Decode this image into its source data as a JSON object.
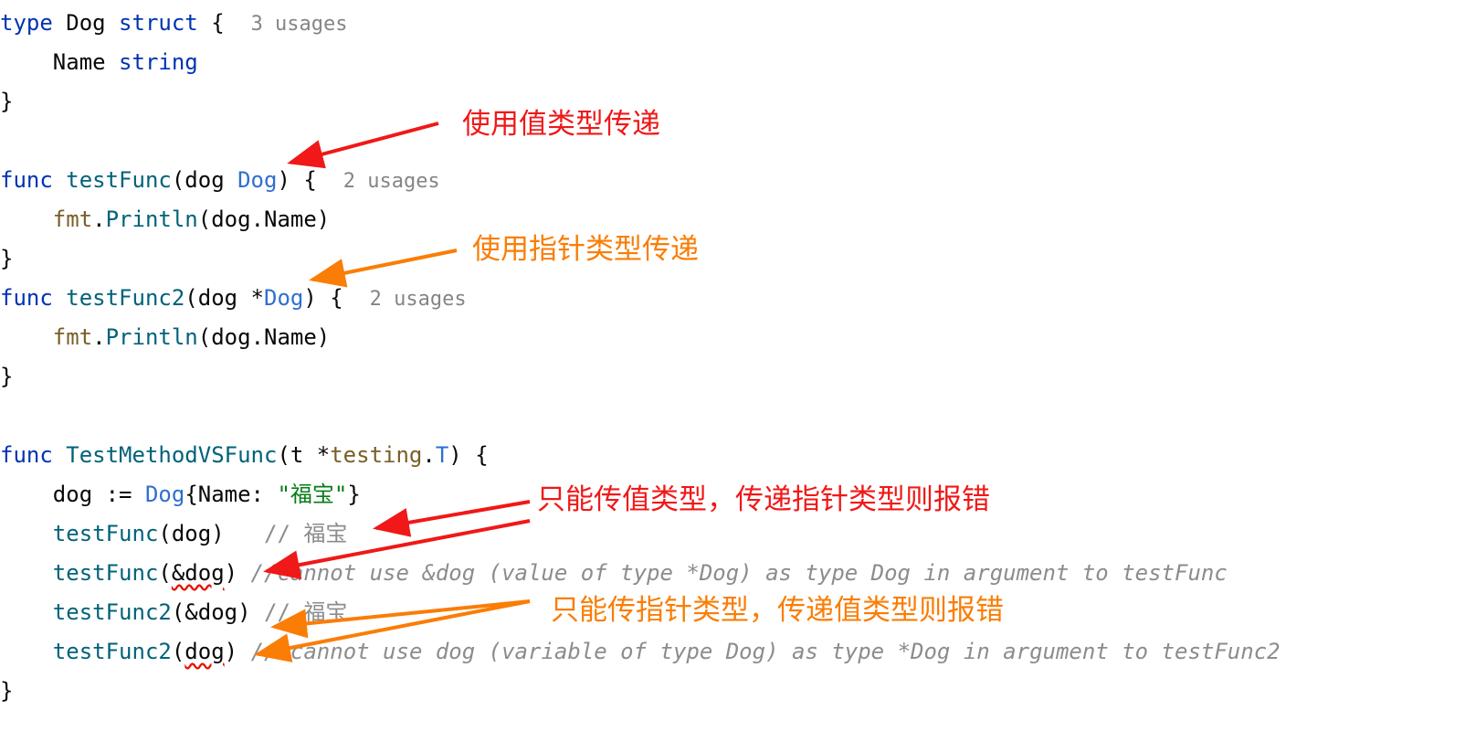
{
  "code": {
    "l1": {
      "kw1": "type",
      "name": " Dog ",
      "kw2": "struct",
      "brace": " {",
      "hint": "3 usages"
    },
    "l2": {
      "indent": "    ",
      "field": "Name ",
      "type": "string"
    },
    "l3": {
      "text": "}"
    },
    "l5": {
      "kw": "func",
      "sp": " ",
      "fn": "testFunc",
      "open": "(dog ",
      "type": "Dog",
      "close": ") {",
      "hint": "2 usages"
    },
    "l6": {
      "indent": "    ",
      "pkg": "fmt",
      "dot": ".",
      "fn": "Println",
      "args": "(dog.Name)"
    },
    "l7": {
      "text": "}"
    },
    "l8": {
      "kw": "func",
      "sp": " ",
      "fn": "testFunc2",
      "open": "(dog *",
      "type": "Dog",
      "close": ") {",
      "hint": "2 usages"
    },
    "l9": {
      "indent": "    ",
      "pkg": "fmt",
      "dot": ".",
      "fn": "Println",
      "args": "(dog.Name)"
    },
    "l10": {
      "text": "}"
    },
    "l12": {
      "kw": "func",
      "sp": " ",
      "fn": "TestMethodVSFunc",
      "open": "(t *",
      "pkg": "testing",
      "dot": ".",
      "type": "T",
      "close": ") {"
    },
    "l13": {
      "indent": "    ",
      "pre": "dog := ",
      "type": "Dog",
      "mid": "{Name: ",
      "str": "\"福宝\"",
      "end": "}"
    },
    "l14": {
      "indent": "    ",
      "fn": "testFunc",
      "args": "(dog)",
      "gap": "   ",
      "comment": "// 福宝"
    },
    "l15": {
      "indent": "    ",
      "fn": "testFunc",
      "open": "(",
      "err": "&dog",
      "close": ")",
      "gap": " ",
      "comment": "//cannot use &dog (value of type *Dog) as type Dog in argument to testFunc"
    },
    "l16": {
      "indent": "    ",
      "fn": "testFunc2",
      "args": "(&dog)",
      "gap": " ",
      "comment": "// 福宝"
    },
    "l17": {
      "indent": "    ",
      "fn": "testFunc2",
      "open": "(",
      "err": "dog",
      "close": ")",
      "gap": " ",
      "comment": "// cannot use dog (variable of type Dog) as type *Dog in argument to testFunc2"
    },
    "l18": {
      "text": "}"
    }
  },
  "annotations": {
    "value_pass": "使用值类型传递",
    "pointer_pass": "使用指针类型传递",
    "value_only": "只能传值类型，传递指针类型则报错",
    "pointer_only": "只能传指针类型，传递值类型则报错"
  },
  "colors": {
    "red": "#f01818",
    "orange": "#fa7d05"
  }
}
